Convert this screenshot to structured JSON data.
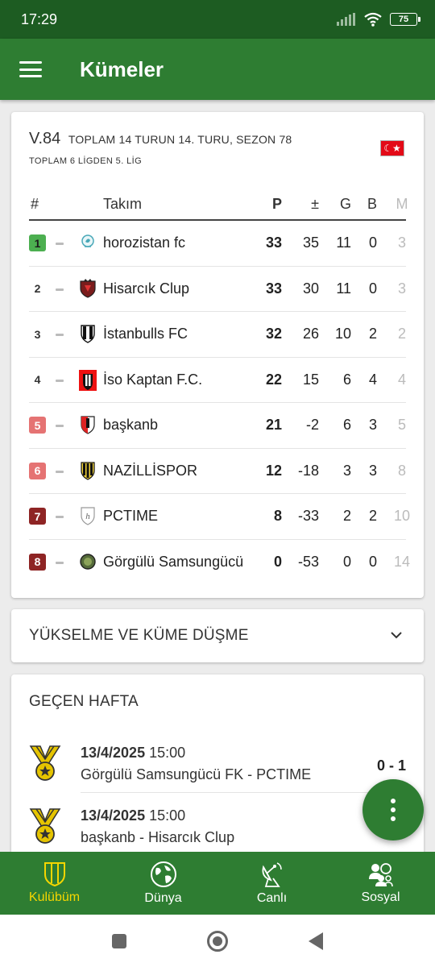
{
  "status_bar": {
    "time": "17:29",
    "battery": "75"
  },
  "app_bar": {
    "title": "Kümeler"
  },
  "league": {
    "code": "V.84",
    "round_info": "TOPLAM 14 TURUN 14. TURU, SEZON 78",
    "league_info": "TOPLAM 6 LİGDEN 5. LİG",
    "flag": "turkey-flag",
    "columns": {
      "rank": "#",
      "team": "Takım",
      "points": "P",
      "diff": "±",
      "won": "G",
      "draw": "B",
      "lost": "M"
    },
    "rows": [
      {
        "rank": "1",
        "team": "horozistan fc",
        "points": "33",
        "diff": "35",
        "won": "11",
        "draw": "0",
        "lost": "3",
        "rank_color": "#4caf50",
        "crest": "rooster-crest"
      },
      {
        "rank": "2",
        "team": "Hisarcık Clup",
        "points": "33",
        "diff": "30",
        "won": "11",
        "draw": "0",
        "lost": "3",
        "rank_color": "",
        "crest": "red-black-shield-crest"
      },
      {
        "rank": "3",
        "team": "İstanbulls FC",
        "points": "32",
        "diff": "26",
        "won": "10",
        "draw": "2",
        "lost": "2",
        "rank_color": "",
        "crest": "black-white-shield-crest"
      },
      {
        "rank": "4",
        "team": "İso Kaptan F.C.",
        "points": "22",
        "diff": "15",
        "won": "6",
        "draw": "4",
        "lost": "4",
        "rank_color": "",
        "crest": "red-square-crest"
      },
      {
        "rank": "5",
        "team": "başkanb",
        "points": "21",
        "diff": "-2",
        "won": "6",
        "draw": "3",
        "lost": "5",
        "rank_color": "#e57373",
        "crest": "red-white-shield-crest"
      },
      {
        "rank": "6",
        "team": "NAZİLLİSPOR",
        "points": "12",
        "diff": "-18",
        "won": "3",
        "draw": "3",
        "lost": "8",
        "rank_color": "#e57373",
        "crest": "black-yellow-shield-crest"
      },
      {
        "rank": "7",
        "team": "PCTIME",
        "points": "8",
        "diff": "-33",
        "won": "2",
        "draw": "2",
        "lost": "10",
        "rank_color": "#8e2424",
        "crest": "white-h-shield-crest"
      },
      {
        "rank": "8",
        "team": "Görgülü Samsungücü",
        "points": "0",
        "diff": "-53",
        "won": "0",
        "draw": "0",
        "lost": "14",
        "rank_color": "#8e2424",
        "crest": "green-round-crest"
      }
    ]
  },
  "promotion": {
    "label": "YÜKSELME VE KÜME DÜŞME",
    "icon": "chevron-down-icon"
  },
  "last_week": {
    "label": "GEÇEN HAFTA",
    "matches": [
      {
        "date": "13/4/2025",
        "time": "15:00",
        "teams": "Görgülü Samsungücü FK - PCTIME",
        "score": "0 - 1",
        "icon": "medal-icon"
      },
      {
        "date": "13/4/2025",
        "time": "15:00",
        "teams": "başkanb - Hisarcık Clup",
        "score": "",
        "icon": "medal-icon"
      }
    ]
  },
  "bottom_nav": [
    {
      "label": "Kulübüm",
      "icon": "shield-icon",
      "active": true
    },
    {
      "label": "Dünya",
      "icon": "globe-icon",
      "active": false
    },
    {
      "label": "Canlı",
      "icon": "satellite-dish-icon",
      "active": false
    },
    {
      "label": "Sosyal",
      "icon": "people-icon",
      "active": false
    }
  ],
  "colors": {
    "primary": "#2e7d32",
    "status_bar": "#1d5c22",
    "active_nav": "#f5d600",
    "medal_gold": "#e5c400"
  }
}
